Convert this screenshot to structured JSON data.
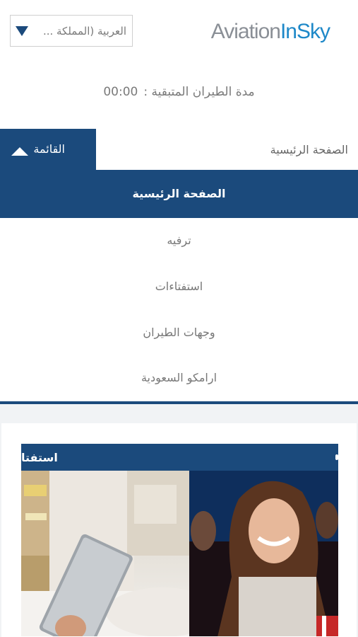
{
  "header": {
    "language_selector": "العربية (المملكة ...",
    "logo_part1": "Aviation",
    "logo_part2": "InSky"
  },
  "flight_time": {
    "label": "مدة الطيران المتبقية :",
    "value": "00:00"
  },
  "nav": {
    "menu_label": "القائمة",
    "current_page": "الصفحة الرئيسية"
  },
  "menu": {
    "items": [
      {
        "label": "الصفحة الرئيسية",
        "active": true
      },
      {
        "label": "ترفيه",
        "active": false
      },
      {
        "label": "استفتاءات",
        "active": false
      },
      {
        "label": "وجهات الطيران",
        "active": false
      },
      {
        "label": "ارامكو السعودية",
        "active": false
      }
    ]
  },
  "content": {
    "promo_title": "استفتا"
  },
  "colors": {
    "primary": "#1b4a7c",
    "logo_gray": "#8a8f96",
    "logo_blue": "#1e88c8",
    "background_light": "#f1f3f5"
  },
  "icons": {
    "language_caret": "triangle-down",
    "menu_toggle": "triangle-up"
  }
}
